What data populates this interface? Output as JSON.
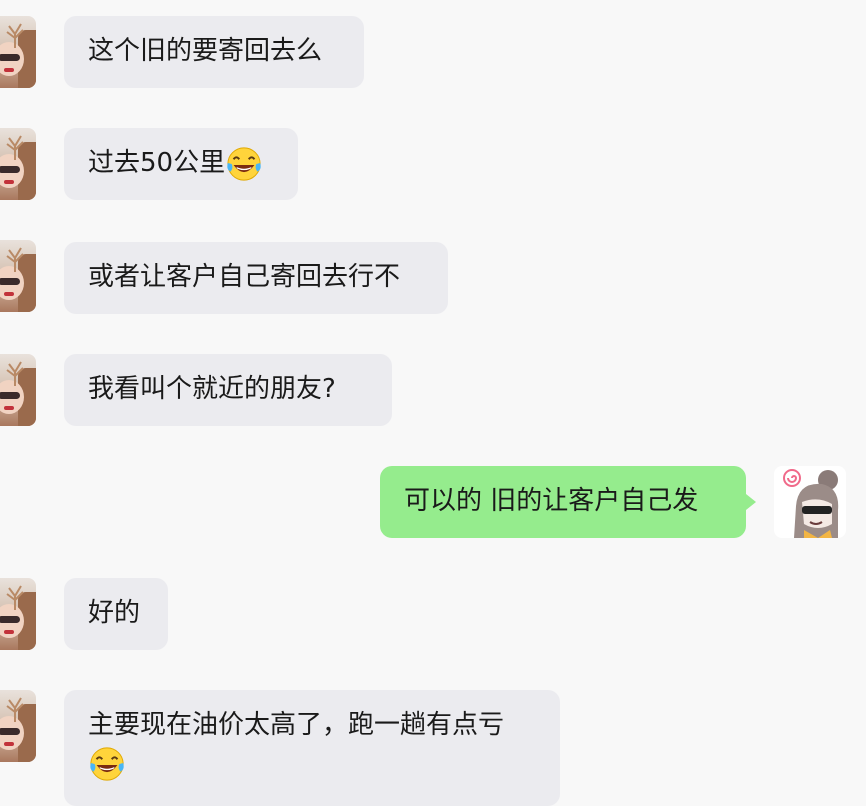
{
  "chat": {
    "messages": [
      {
        "side": "in",
        "text": "这个旧的要寄回去么",
        "emoji": ""
      },
      {
        "side": "in",
        "text": "过去50公里",
        "emoji": "tears-of-joy"
      },
      {
        "side": "in",
        "text": "或者让客户自己寄回去行不",
        "emoji": ""
      },
      {
        "side": "in",
        "text": "我看叫个就近的朋友?",
        "emoji": ""
      },
      {
        "side": "out",
        "text": "可以的 旧的让客户自己发",
        "emoji": ""
      },
      {
        "side": "in",
        "text": "好的",
        "emoji": ""
      },
      {
        "side": "in",
        "text": "主要现在油价太高了，跑一趟有点亏",
        "emoji": "tears-of-joy"
      }
    ]
  },
  "colors": {
    "background": "#f8f8f8",
    "incoming_bubble": "#ebebef",
    "outgoing_bubble": "#95ec8d",
    "text": "#1a1a1a"
  }
}
